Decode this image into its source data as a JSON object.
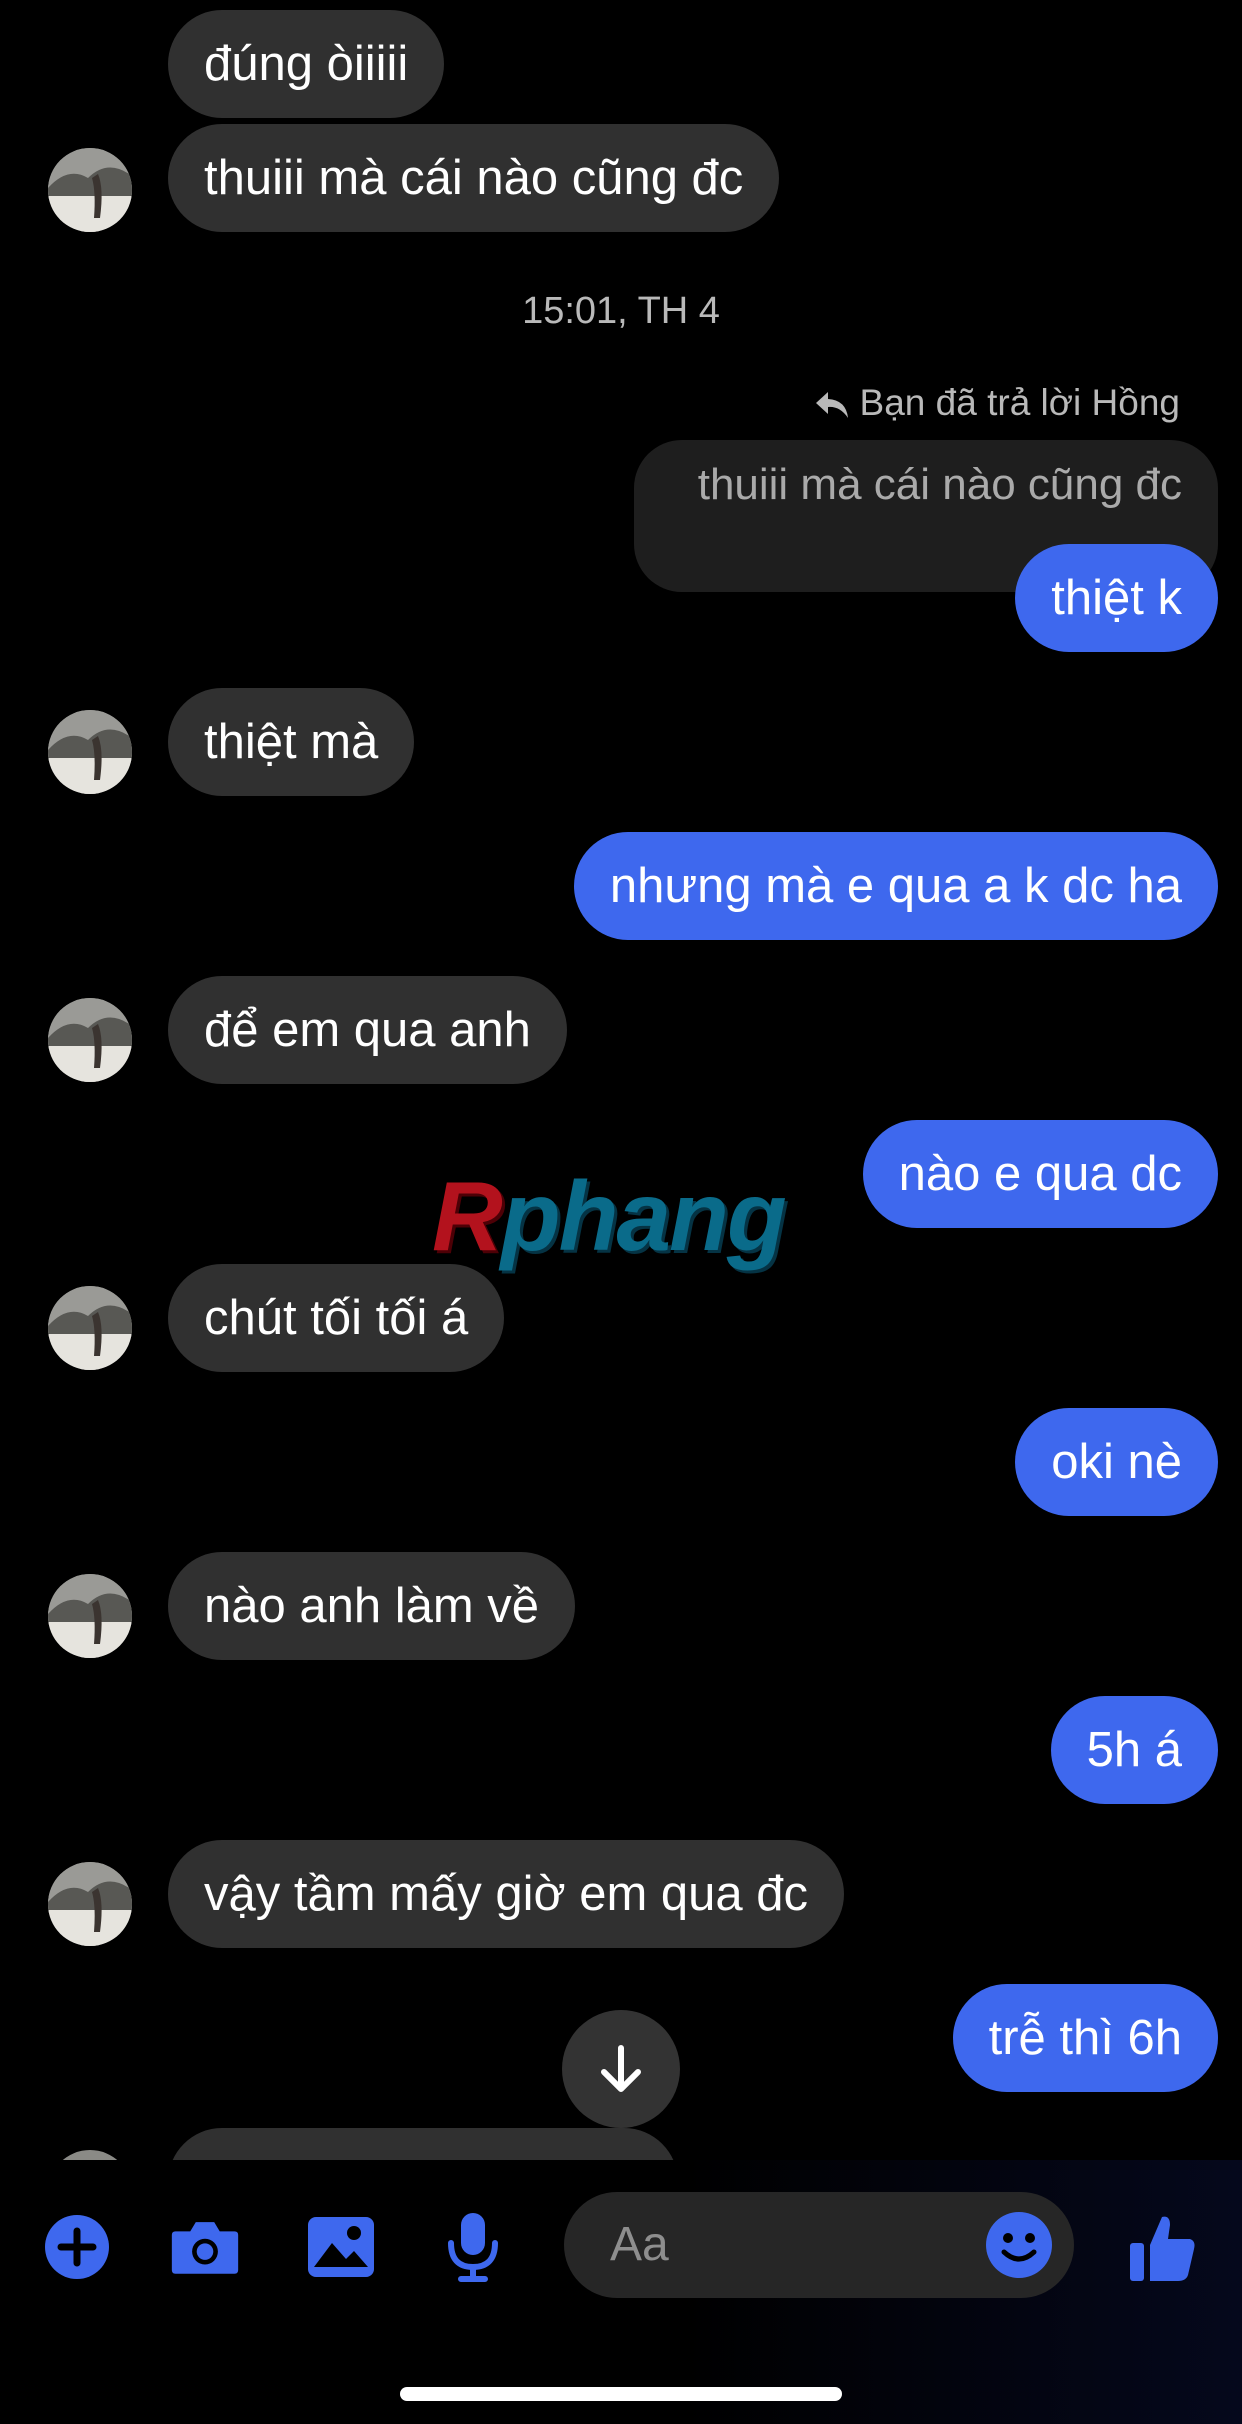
{
  "colors": {
    "accent": "#3e68ee",
    "incoming_bubble": "#303030",
    "background": "#000000"
  },
  "messages": [
    {
      "dir": "in",
      "text": "đúng òiiiii"
    },
    {
      "dir": "in",
      "text": "thuiii mà cái nào cũng đc"
    },
    {
      "dir": "out",
      "text": "thiệt k"
    },
    {
      "dir": "in",
      "text": "thiệt mà"
    },
    {
      "dir": "out",
      "text": "nhưng mà e qua a k dc ha"
    },
    {
      "dir": "in",
      "text": "để em qua anh"
    },
    {
      "dir": "out",
      "text": "nào e qua dc"
    },
    {
      "dir": "in",
      "text": "chút tối tối á"
    },
    {
      "dir": "out",
      "text": "oki nè"
    },
    {
      "dir": "in",
      "text": "nào anh làm về"
    },
    {
      "dir": "out",
      "text": "5h á"
    },
    {
      "dir": "in",
      "text": "vậy tầm mấy giờ em qua đc"
    },
    {
      "dir": "out",
      "text": "trễ thì 6h"
    }
  ],
  "timestamp": "15:01, TH 4",
  "reply": {
    "note": "Bạn đã trả lời Hồng",
    "quoted": "thuiii mà cái nào cũng đc"
  },
  "watermark": {
    "r": "R",
    "rest": "phang"
  },
  "composer": {
    "placeholder": "Aa"
  },
  "icons": [
    "plus-icon",
    "camera-icon",
    "image-icon",
    "microphone-icon",
    "emoji-icon",
    "thumbs-up-icon",
    "arrow-down-icon",
    "reply-arrow-icon"
  ]
}
